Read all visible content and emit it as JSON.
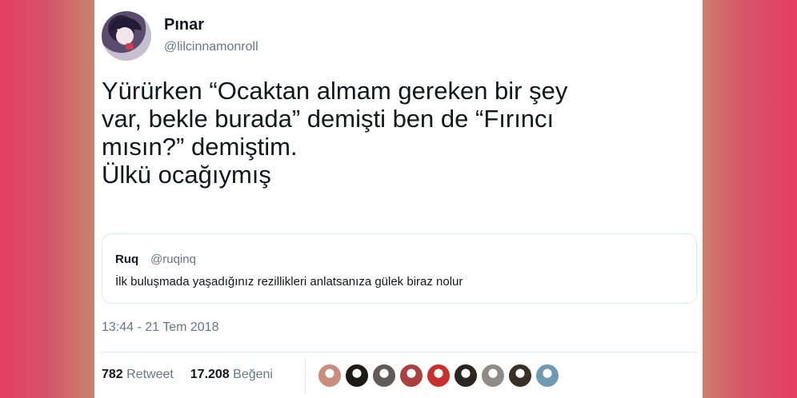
{
  "tweet": {
    "author_name": "Pınar",
    "author_handle": "@lilcinnamonroll",
    "text_lines": [
      "Yürürken “Ocaktan almam gereken bir şey",
      "var, bekle burada” demişti ben de “Fırıncı",
      "mısın?” demiştim.",
      "Ülkü ocağıymış"
    ],
    "timestamp": "13:44 - 21 Tem 2018"
  },
  "quoted_tweet": {
    "author_name": "Ruq",
    "author_handle": "@ruqinq",
    "text": "İlk buluşmada yaşadığınız rezillikleri anlatsanıza gülek biraz nolur"
  },
  "stats": {
    "retweet_count": "782",
    "retweet_label": "Retweet",
    "like_count": "17.208",
    "like_label": "Beğeni"
  },
  "likers": [
    {
      "name": "liker-avatar-1",
      "color": "#c98d7b"
    },
    {
      "name": "liker-avatar-2",
      "color": "#1c1a18"
    },
    {
      "name": "liker-avatar-3",
      "color": "#5e5b58"
    },
    {
      "name": "liker-avatar-4",
      "color": "#a9423f"
    },
    {
      "name": "liker-avatar-5",
      "color": "#c9302c"
    },
    {
      "name": "liker-avatar-6",
      "color": "#2b2622"
    },
    {
      "name": "liker-avatar-7",
      "color": "#8f8b87"
    },
    {
      "name": "liker-avatar-8",
      "color": "#3a2f24"
    },
    {
      "name": "liker-avatar-9",
      "color": "#6e9bb3"
    }
  ]
}
